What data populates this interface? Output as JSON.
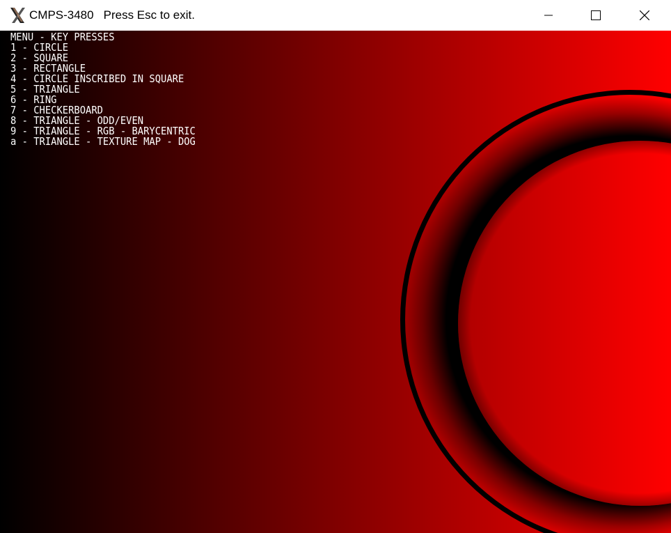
{
  "window": {
    "title": "CMPS-3480",
    "hint": "Press Esc to exit.",
    "icon": "x-window-icon",
    "controls": {
      "minimize_icon": "minimize-icon",
      "maximize_icon": "maximize-icon",
      "close_icon": "close-icon"
    }
  },
  "menu": {
    "heading": "MENU - KEY PRESSES",
    "items": [
      {
        "label": "1 - CIRCLE"
      },
      {
        "label": "2 - SQUARE"
      },
      {
        "label": "3 - RECTANGLE"
      },
      {
        "label": "4 - CIRCLE INSCRIBED IN SQUARE"
      },
      {
        "label": "5 - TRIANGLE"
      },
      {
        "label": "6 - RING"
      },
      {
        "label": "7 - CHECKERBOARD"
      },
      {
        "label": "8 - TRIANGLE - ODD/EVEN"
      },
      {
        "label": "9 - TRIANGLE - RGB - BARYCENTRIC"
      },
      {
        "label": "a - TRIANGLE - TEXTURE MAP - DOG"
      }
    ]
  },
  "colors": {
    "background_start": "#000000",
    "background_end": "#ff0000",
    "text": "#ffffff",
    "ring_dark": "#000000",
    "ring_bright": "#ff0000"
  }
}
